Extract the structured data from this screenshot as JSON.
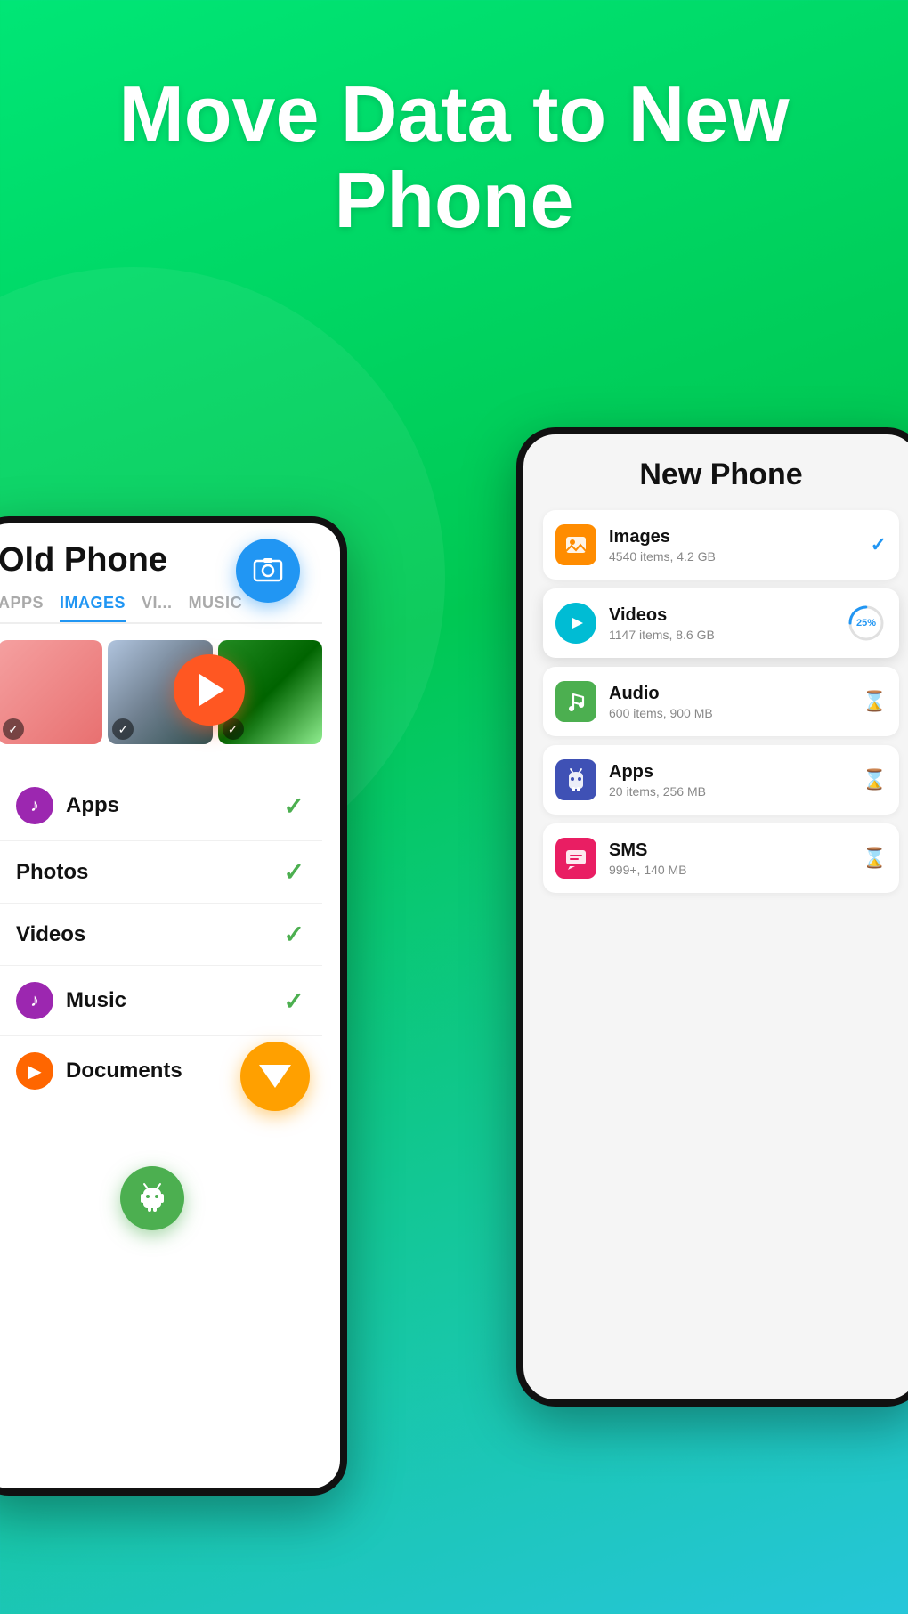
{
  "hero": {
    "title": "Move Data to New Phone"
  },
  "old_phone": {
    "title": "Old Phone",
    "tabs": [
      {
        "label": "APPS",
        "active": false
      },
      {
        "label": "IMAGES",
        "active": true
      },
      {
        "label": "VI...",
        "active": false
      },
      {
        "label": "MUSIC",
        "active": false
      }
    ],
    "list_items": [
      {
        "label": "Apps",
        "icon": "🎵",
        "icon_color": "purple",
        "checked": true
      },
      {
        "label": "Photos",
        "icon": null,
        "icon_color": null,
        "checked": true
      },
      {
        "label": "Videos",
        "icon": null,
        "icon_color": null,
        "checked": true
      },
      {
        "label": "Music",
        "icon": "🎵",
        "icon_color": "purple",
        "checked": true
      },
      {
        "label": "Documents",
        "icon": "▶",
        "icon_color": "orange",
        "checked": false
      }
    ]
  },
  "new_phone": {
    "title": "New Phone",
    "items": [
      {
        "label": "Images",
        "sub": "4540 items, 4.2 GB",
        "status": "check",
        "icon": "🖼",
        "icon_bg": "img"
      },
      {
        "label": "Videos",
        "sub": "1147 items, 8.6 GB",
        "status": "25%",
        "icon": "▶",
        "icon_bg": "vid"
      },
      {
        "label": "Audio",
        "sub": "600 items, 900 MB",
        "status": "hourglass",
        "icon": "♪",
        "icon_bg": "aud"
      },
      {
        "label": "Apps",
        "sub": "20 items, 256 MB",
        "status": "hourglass",
        "icon": "🤖",
        "icon_bg": "app"
      },
      {
        "label": "SMS",
        "sub": "999+, 140 MB",
        "status": "hourglass",
        "icon": "✉",
        "icon_bg": "sms"
      }
    ]
  },
  "progress": {
    "videos_pct": 25,
    "circumference": 113
  }
}
